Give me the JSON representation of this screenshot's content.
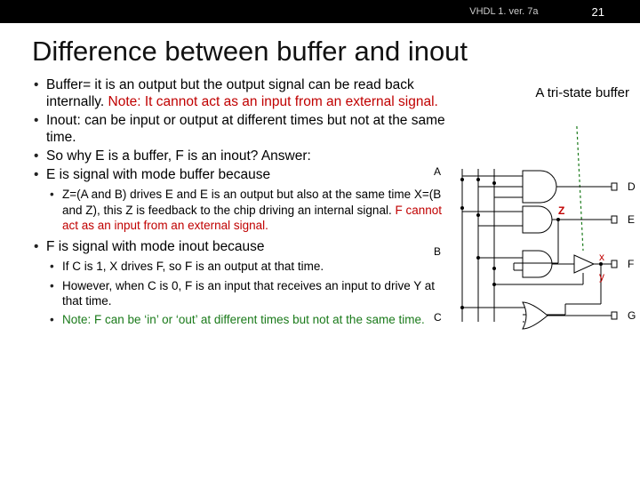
{
  "header": {
    "doc_id": "VHDL 1. ver. 7a",
    "page_num": "21"
  },
  "title": "Difference between buffer and inout",
  "bullets": {
    "b1_a": "Buffer= it is an output but the output signal can be read back internally. ",
    "b1_note": "Note: It cannot act as an input from an external signal.",
    "b2": "Inout: can be input or output at different times but not at the same time.",
    "b3": "So why E is a buffer, F is an inout? Answer:",
    "b4": "E is signal with mode buffer because",
    "b4_1a": "Z=(A and B) drives E and E is an output but also at the same time X=(B and Z), this Z is feedback to the chip driving an internal signal. ",
    "b4_1b": "F cannot act as an input from an external signal.",
    "b5": "F is signal with mode inout because",
    "b5_1": "If C is 1, X drives F, so F is an output at that time.",
    "b5_2": "However, when C is 0, F is an input that receives an input to drive Y at that time.",
    "b5_3a": "Note: ",
    "b5_3b": "F can be ‘in’ or ‘out’ at different times but not at the same time."
  },
  "diagram": {
    "tri_label": "A tri-state buffer",
    "A": "A",
    "B": "B",
    "C": "C",
    "D": "D",
    "E": "E",
    "F": "F",
    "G": "G",
    "Z": "Z",
    "x": "x",
    "y": "y"
  }
}
